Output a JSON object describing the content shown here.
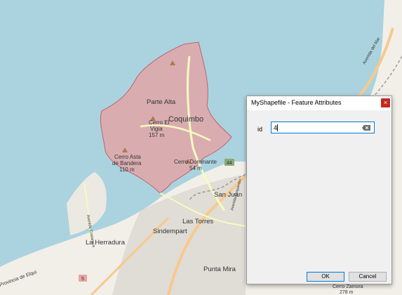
{
  "map": {
    "labels": {
      "coquimbo": "Coquimbo",
      "parte_alta": "Parte Alta",
      "cerro_el_vigia_1": "Cerro El",
      "cerro_el_vigia_2": "Vigia",
      "cerro_el_vigia_3": "157 m",
      "cerro_asta_1": "Cerro Asta",
      "cerro_asta_2": "de Bandera",
      "cerro_asta_3": "110 m",
      "cerro_dominante_1": "Cerro Dominante",
      "cerro_dominante_2": "54 m",
      "san_juan": "San Juan",
      "las_torres": "Las Torres",
      "sindempart": "Sindempart",
      "la_herradura": "La Herradura",
      "punta_mira": "Punta Mira",
      "provincia": "Provincia de Elqui",
      "avenida_del_mar": "Avenida del Mar",
      "avenida_costanera": "Avenida Costanera",
      "avenida_coquimbo": "Avenida Coquimbo",
      "route_44": "44",
      "route_5": "5",
      "cerro_zamora_1": "Cerro Zamora",
      "cerro_zamora_2": "278 m"
    },
    "colors": {
      "sea": "#aad3df",
      "land": "#f2efe9",
      "polygon_fill": "#e8a0a0",
      "polygon_stroke": "#c06070",
      "major_road": "#f7c98e",
      "secondary_road": "#f7fabf"
    }
  },
  "dialog": {
    "title": "MyShapefile - Feature Attributes",
    "close_label": "×",
    "field_label": "id",
    "field_value": "4",
    "ok_label": "OK",
    "cancel_label": "Cancel"
  }
}
